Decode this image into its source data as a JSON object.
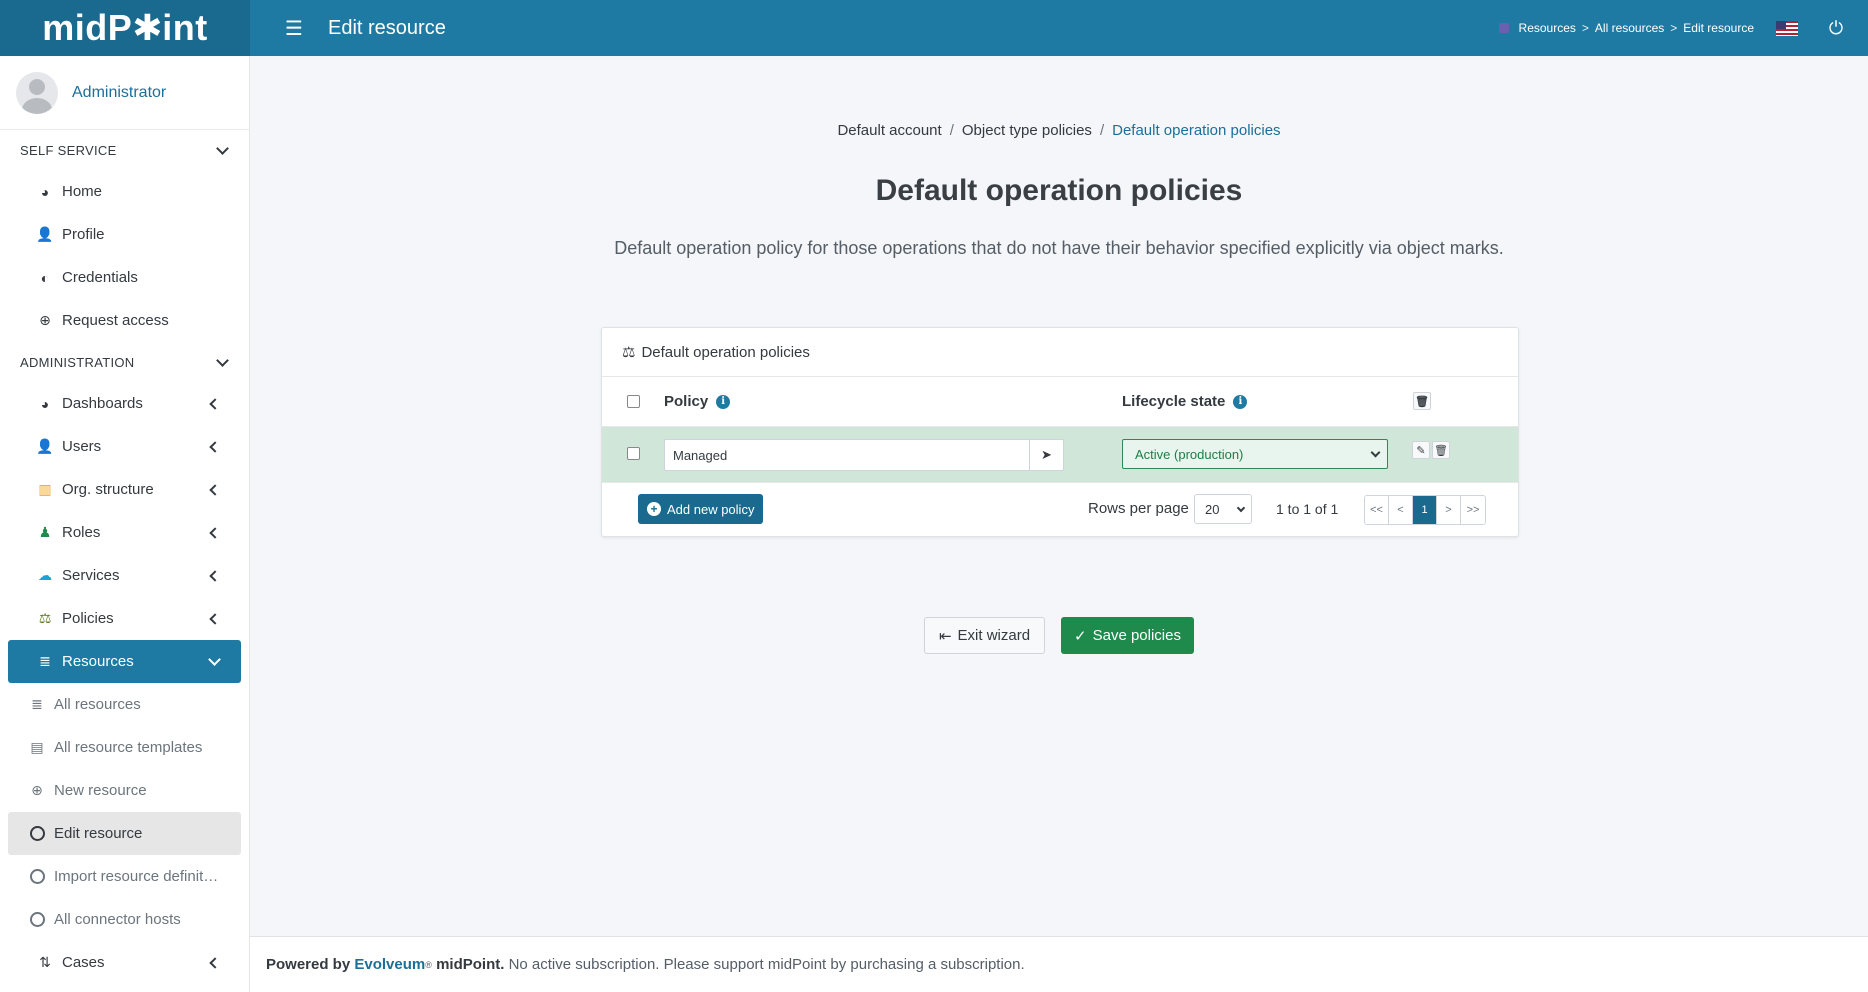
{
  "app": {
    "logo_text_left": "midP",
    "logo_star": "✱",
    "logo_text_right": "int",
    "page_heading": "Edit resource"
  },
  "topbar": {
    "breadcrumbs": [
      "Resources",
      "All resources",
      "Edit resource"
    ],
    "separator": ">"
  },
  "sidebar": {
    "user_name": "Administrator",
    "self_service": {
      "title": "SELF SERVICE",
      "items": [
        {
          "label": "Home",
          "icon": "dashboard-icon"
        },
        {
          "label": "Profile",
          "icon": "user-icon"
        },
        {
          "label": "Credentials",
          "icon": "shield-icon"
        },
        {
          "label": "Request access",
          "icon": "plus-circle-icon"
        }
      ]
    },
    "administration": {
      "title": "ADMINISTRATION",
      "items": [
        {
          "label": "Dashboards",
          "icon": "dashboard-icon"
        },
        {
          "label": "Users",
          "icon": "user-icon"
        },
        {
          "label": "Org. structure",
          "icon": "building-icon"
        },
        {
          "label": "Roles",
          "icon": "role-icon"
        },
        {
          "label": "Services",
          "icon": "cloud-icon"
        },
        {
          "label": "Policies",
          "icon": "scale-icon"
        },
        {
          "label": "Resources",
          "icon": "database-icon"
        }
      ],
      "resources_sub": [
        {
          "label": "All resources"
        },
        {
          "label": "All resource templates"
        },
        {
          "label": "New resource"
        },
        {
          "label": "Edit resource"
        },
        {
          "label": "Import resource definit…"
        },
        {
          "label": "All connector hosts"
        }
      ],
      "cases": {
        "label": "Cases"
      }
    }
  },
  "wizard": {
    "steps": [
      "Default account",
      "Object type policies",
      "Default operation policies"
    ],
    "title": "Default operation policies",
    "description": "Default operation policy for those operations that do not have their behavior specified explicitly via object marks."
  },
  "table": {
    "card_title": "Default operation policies",
    "columns": {
      "policy": "Policy",
      "lifecycle": "Lifecycle state"
    },
    "rows": [
      {
        "policy": "Managed",
        "lifecycle": "Active (production)"
      }
    ],
    "add_button": "Add new policy",
    "rows_per_page_label": "Rows per page",
    "rows_per_page": "20",
    "count": "1 to 1 of 1",
    "pager": [
      "<<",
      "<",
      "1",
      ">",
      ">>"
    ]
  },
  "actions": {
    "exit": "Exit wizard",
    "save": "Save policies"
  },
  "footer": {
    "powered_by": "Powered by",
    "brand": "Evolveum",
    "reg": "®",
    "product": "midPoint.",
    "note": "No active subscription. Please support midPoint by purchasing a subscription."
  },
  "colors": {
    "navbar": "#1f7aa3",
    "active_nav": "#1f7aa3",
    "row_highlight": "#cfe6d9",
    "save_button": "#1e8a4c"
  }
}
